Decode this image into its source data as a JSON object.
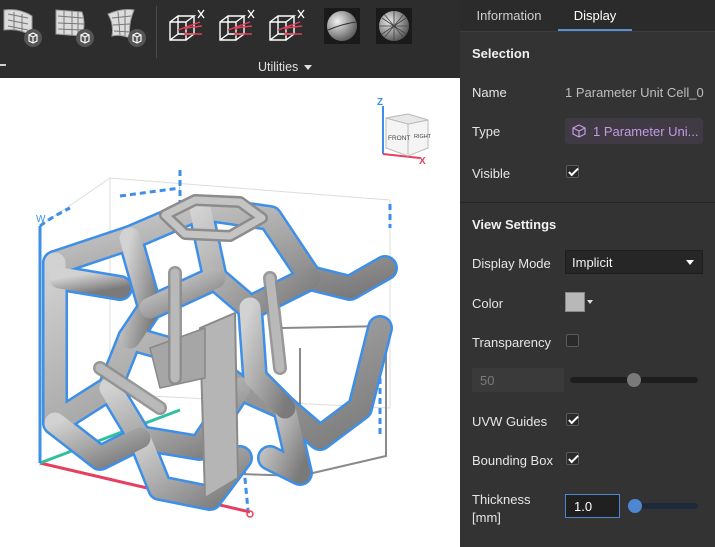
{
  "toolbar": {
    "icons": [
      "lattice-wrap-icon",
      "lattice-sheet-icon",
      "lattice-curve-icon",
      "cut-cell-icon",
      "cut-cell-icon",
      "cut-cell-icon",
      "sphere-solid-icon",
      "sphere-wire-icon"
    ],
    "utilities_label": "Utilities"
  },
  "viewport": {
    "axis_labels": {
      "z": "Z",
      "x": "X",
      "w": "W"
    },
    "view_cube": {
      "front": "FRONT",
      "right": "RIGHT"
    },
    "colors": {
      "bounding": "#3d8fe8",
      "part": "#a9a9a9",
      "uvw_u": "#e64060",
      "uvw_v": "#30c0a0",
      "uvw_w": "#3d8fe8"
    }
  },
  "panel": {
    "tabs": [
      {
        "label": "Information",
        "active": false
      },
      {
        "label": "Display",
        "active": true
      }
    ],
    "selection": {
      "title": "Selection",
      "name_label": "Name",
      "name_value": "1 Parameter Unit Cell_0",
      "type_label": "Type",
      "type_value": "1 Parameter Uni...",
      "type_icon": "unit-cell-icon",
      "visible_label": "Visible",
      "visible_checked": true
    },
    "view_settings": {
      "title": "View Settings",
      "display_mode_label": "Display Mode",
      "display_mode_value": "Implicit",
      "color_label": "Color",
      "color_value": "#b8b8b8",
      "transparency_label": "Transparency",
      "transparency_checked": false,
      "transparency_value": "50",
      "transparency_fraction": 0.5,
      "uvw_label": "UVW Guides",
      "uvw_checked": true,
      "bbox_label": "Bounding Box",
      "bbox_checked": true,
      "thickness_label_1": "Thickness",
      "thickness_label_2": "[mm]",
      "thickness_value": "1.0",
      "thickness_fraction": 0.1
    },
    "colors": {
      "accent": "#5a8fd6",
      "type_text": "#c49ae0"
    }
  }
}
